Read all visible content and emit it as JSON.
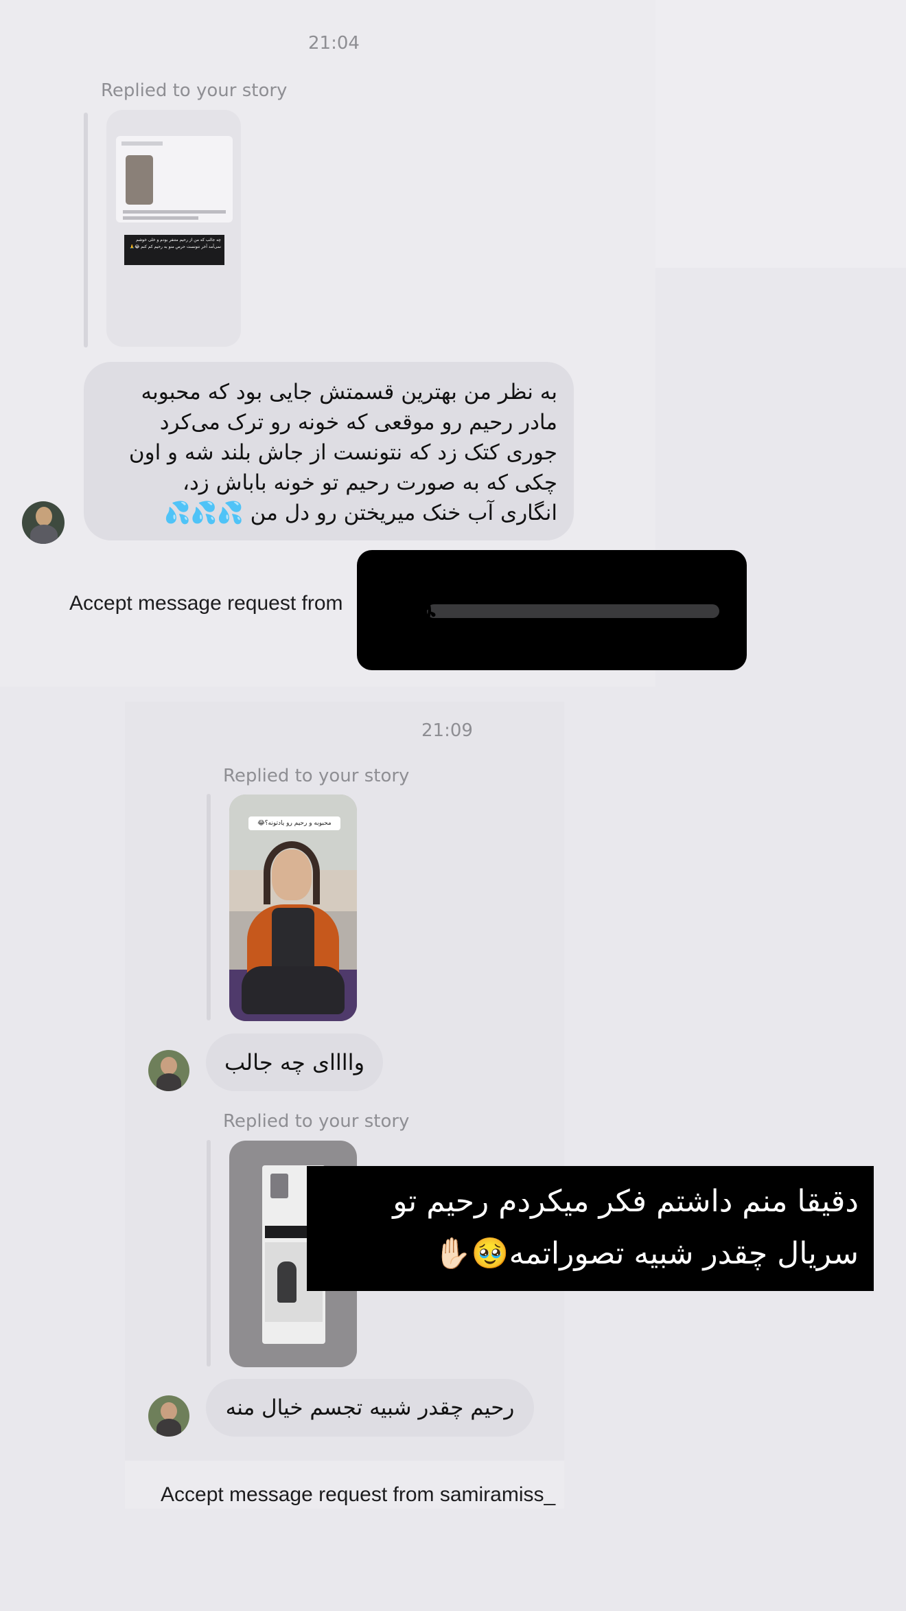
{
  "section_one": {
    "timestamp": "21:04",
    "reply_label": "Replied to your story",
    "story_caption": "چه جالب که من از رحیم متنفر بودم و خلی خوشم نمی‌آمد آخر نتونست حرص منو به رحیم کم کنم 😂🙏",
    "message_lines": [
      "به نظر من بهترین قسمتش جایی بود که محبوبه",
      "مادر رحیم رو موقعی که خونه رو ترک می‌کرد",
      "جوری کتک زد که نتونست از جاش بلند شه و اون",
      "چکی که به صورت رحیم تو خونه باباش زد،",
      "انگاری آب خنک میریختن رو دل من 💦💦💦"
    ],
    "accept_text": "Accept message request from"
  },
  "reaction_overlay": {
    "emoji": "😂",
    "slider_level": 0.0
  },
  "section_two": {
    "timestamp": "21:09",
    "reply_label_1": "Replied to your story",
    "story_1_caption": "محبوبه و رحیم رو یادتونه؟😂",
    "message_1": "واااای چه جالب",
    "reply_label_2": "Replied to your story",
    "message_2": "رحیم چقدر شبیه تجسم خیال منه",
    "accept_text": "Accept message request from samiramiss_"
  },
  "caption_overlay": {
    "lines": [
      "دقیقا منم داشتم فکر میکردم رحیم تو",
      "سریال چقدر شبیه تصوراتمه🥹✋🏻"
    ]
  },
  "colors": {
    "bubble": "#dedde3",
    "timestamp": "#8e8e93",
    "overlay": "#000000"
  }
}
